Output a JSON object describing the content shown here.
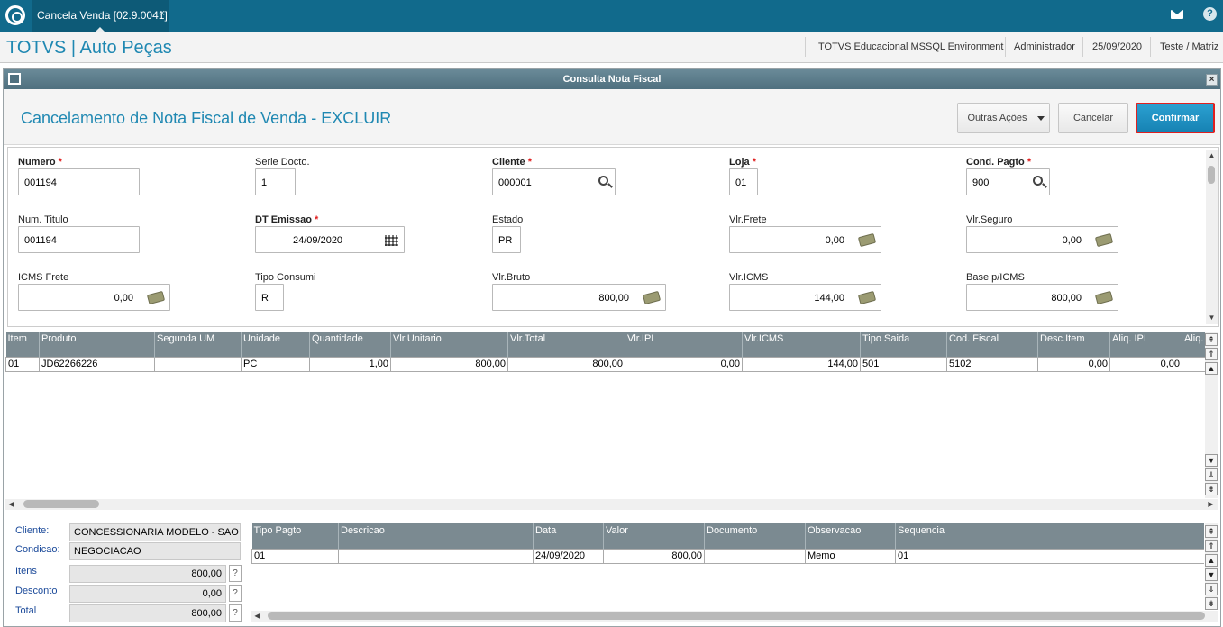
{
  "topbar": {
    "tab_label": "Cancela Venda [02.9.0041]",
    "tab_close": "×",
    "help": "?"
  },
  "appbar": {
    "title": "TOTVS | Auto Peças",
    "environment": "TOTVS Educacional MSSQL Environment",
    "user": "Administrador",
    "date": "25/09/2020",
    "company": "Teste / Matriz"
  },
  "dialog": {
    "title": "Consulta Nota Fiscal",
    "close": "×"
  },
  "header": {
    "title": "Cancelamento de Nota Fiscal de Venda - EXCLUIR",
    "outras_acoes": "Outras Ações",
    "cancelar": "Cancelar",
    "confirmar": "Confirmar"
  },
  "fields": {
    "numero": {
      "label": "Numero",
      "value": "001194"
    },
    "serie": {
      "label": "Serie Docto.",
      "value": "1"
    },
    "cliente": {
      "label": "Cliente",
      "value": "000001"
    },
    "loja": {
      "label": "Loja",
      "value": "01"
    },
    "cond_pagto": {
      "label": "Cond. Pagto",
      "value": "900"
    },
    "num_titulo": {
      "label": "Num. Titulo",
      "value": "001194"
    },
    "dt_emissao": {
      "label": "DT Emissao",
      "value": "24/09/2020"
    },
    "estado": {
      "label": "Estado",
      "value": "PR"
    },
    "vlr_frete": {
      "label": "Vlr.Frete",
      "value": "0,00"
    },
    "vlr_seguro": {
      "label": "Vlr.Seguro",
      "value": "0,00"
    },
    "icms_frete": {
      "label": "ICMS Frete",
      "value": "0,00"
    },
    "tipo_consumi": {
      "label": "Tipo Consumi",
      "value": "R"
    },
    "vlr_bruto": {
      "label": "Vlr.Bruto",
      "value": "800,00"
    },
    "vlr_icms": {
      "label": "Vlr.ICMS",
      "value": "144,00"
    },
    "base_icms": {
      "label": "Base p/ICMS",
      "value": "800,00"
    }
  },
  "required_mark": "*",
  "items_grid": {
    "columns": [
      "Item",
      "Produto",
      "Segunda UM",
      "Unidade",
      "Quantidade",
      "Vlr.Unitario",
      "Vlr.Total",
      "Vlr.IPI",
      "Vlr.ICMS",
      "Tipo Saida",
      "Cod. Fiscal",
      "Desc.Item",
      "Aliq. IPI",
      "Aliq."
    ],
    "rows": [
      [
        "01",
        "JD62266226",
        "",
        "PC",
        "1,00",
        "800,00",
        "800,00",
        "0,00",
        "144,00",
        "501",
        "5102",
        "0,00",
        "0,00",
        ""
      ]
    ]
  },
  "summary": {
    "cliente_label": "Cliente:",
    "cliente_value": "CONCESSIONARIA MODELO - SAO PAULO",
    "condicao_label": "Condicao:",
    "condicao_value": "NEGOCIACAO",
    "itens_label": "Itens",
    "itens_value": "800,00",
    "desconto_label": "Desconto",
    "desconto_value": "0,00",
    "total_label": "Total",
    "total_value": "800,00",
    "help": "?"
  },
  "payments_grid": {
    "columns": [
      "Tipo Pagto",
      "Descricao",
      "Data",
      "Valor",
      "Documento",
      "Observacao",
      "Sequencia"
    ],
    "rows": [
      [
        "01",
        "",
        "24/09/2020",
        "800,00",
        "",
        "Memo",
        "01"
      ]
    ]
  }
}
